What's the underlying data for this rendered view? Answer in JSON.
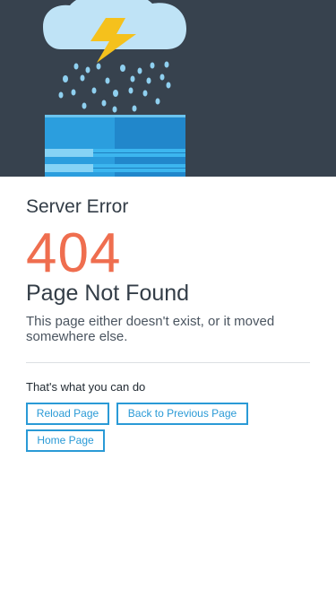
{
  "error": {
    "eyebrow": "Server Error",
    "code": "404",
    "title": "Page Not Found",
    "description": "This page either doesn't exist, or it moved somewhere else."
  },
  "actions": {
    "label": "That's what you can do",
    "buttons": [
      {
        "label": "Reload Page"
      },
      {
        "label": "Back to Previous Page"
      },
      {
        "label": "Home Page"
      }
    ]
  },
  "colors": {
    "hero_bg": "#37424e",
    "accent": "#ef6e4f",
    "link": "#2a9ad6",
    "cloud": "#bfe3f6",
    "lightning": "#f5c11c",
    "rain": "#8fd0f0",
    "server": "#2b9ede"
  },
  "illustration": {
    "icons": [
      "cloud-icon",
      "lightning-icon",
      "rain-icon",
      "server-icon"
    ]
  }
}
